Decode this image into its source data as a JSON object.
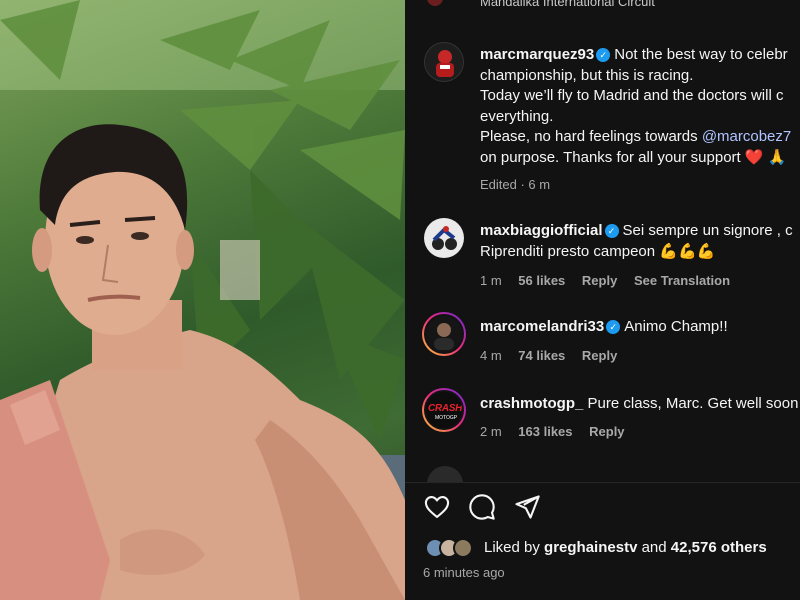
{
  "header": {
    "location": "Mandalika International Circuit"
  },
  "caption": {
    "username": "marcmarquez93",
    "text_1": "Not the best way to celebr",
    "text_2": "championship, but this is racing.",
    "text_3": "Today we’ll fly to Madrid and the doctors will c",
    "text_4": "everything.",
    "text_5": "Please, no hard feelings towards",
    "mention": "@marcobez7",
    "text_6": "on purpose. Thanks for all your support",
    "emoji_heart": "❤️",
    "emoji_pray": "🙏",
    "edited": "Edited · 6 m"
  },
  "comments": [
    {
      "username": "maxbiaggiofficial",
      "text_1": "Sei sempre un signore , c",
      "text_2": "Riprenditi presto campeon",
      "emoji": "💪💪💪",
      "time": "1 m",
      "likes": "56 likes",
      "reply": "Reply",
      "translate": "See Translation"
    },
    {
      "username": "marcomelandri33",
      "text_1": "Animo Champ!!",
      "time": "4 m",
      "likes": "74 likes",
      "reply": "Reply"
    },
    {
      "username": "crashmotogp_",
      "text_1": "Pure class, Marc. Get well soon",
      "time": "2 m",
      "likes": "163 likes",
      "reply": "Reply",
      "avatar_text": "CRASH",
      "avatar_sub": "MOTOGP"
    }
  ],
  "footer": {
    "liked_prefix": "Liked by",
    "liked_user": "greghainestv",
    "liked_mid": "and",
    "liked_count": "42,576 others",
    "time": "6 minutes ago"
  },
  "icons": {
    "like": "heart-icon",
    "comment": "comment-icon",
    "share": "paper-plane-icon",
    "verified": "verified-badge-icon"
  },
  "colors": {
    "panel_bg": "#121212",
    "verified_blue": "#1d9bf0",
    "mention_blue": "#b0c4ff",
    "muted": "#a8a8a8"
  }
}
